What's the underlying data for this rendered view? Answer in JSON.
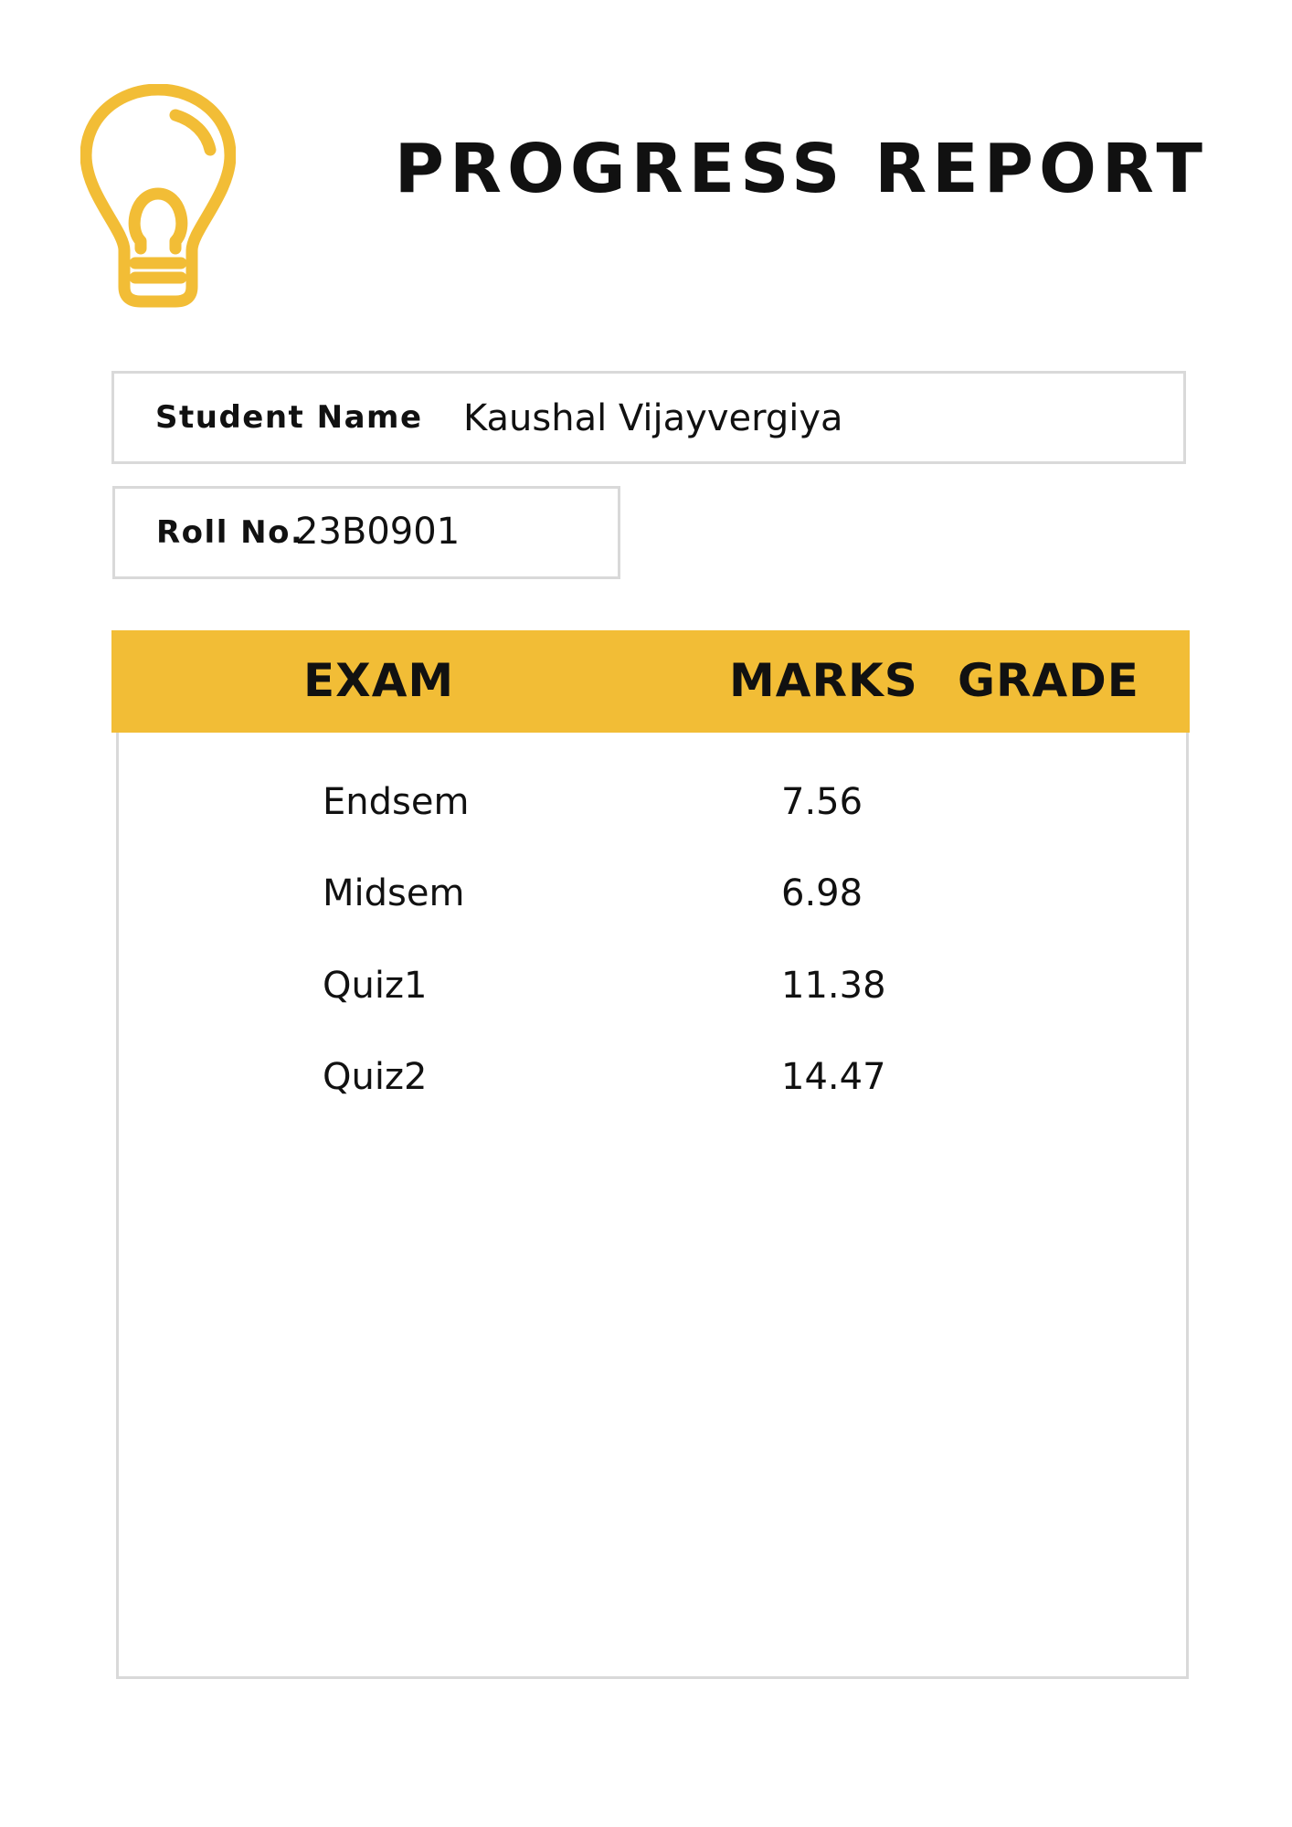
{
  "header": {
    "title": "PROGRESS REPORT",
    "logo_icon": "lightbulb-icon",
    "accent_color": "#f2bd36"
  },
  "student": {
    "name_label": "Student Name",
    "name_value": "Kaushal Vijayvergiya",
    "roll_label": "Roll No.",
    "roll_value": "23B0901"
  },
  "table": {
    "columns": [
      "EXAM",
      "MARKS",
      "GRADE"
    ],
    "rows": [
      {
        "exam": "Endsem",
        "marks": "7.56",
        "grade": ""
      },
      {
        "exam": "Midsem",
        "marks": "6.98",
        "grade": ""
      },
      {
        "exam": "Quiz1",
        "marks": "11.38",
        "grade": ""
      },
      {
        "exam": "Quiz2",
        "marks": "14.47",
        "grade": ""
      }
    ]
  }
}
